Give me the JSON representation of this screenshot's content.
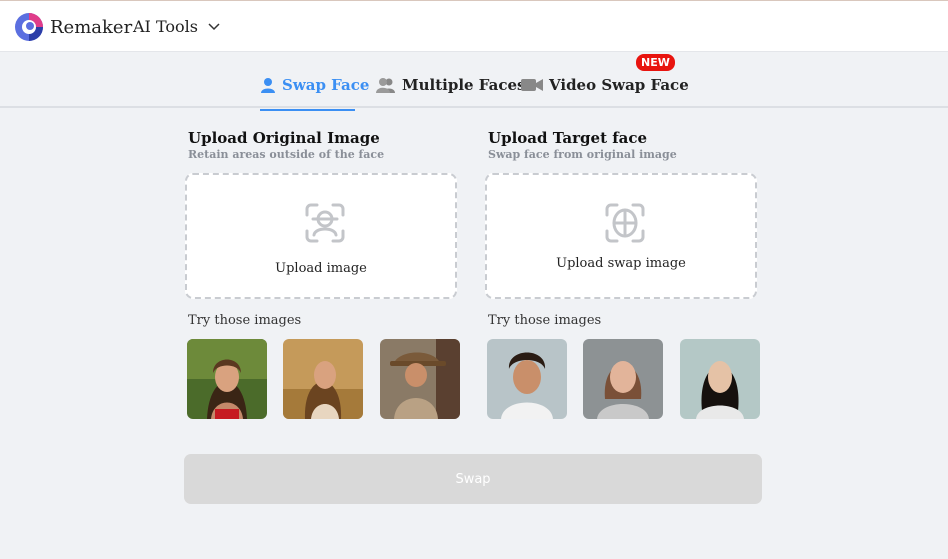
{
  "header": {
    "brand": "Remaker",
    "menu_label": "AI Tools"
  },
  "tabs": [
    {
      "label": "Swap Face",
      "active": true,
      "icon": "person-icon"
    },
    {
      "label": "Multiple Faces",
      "active": false,
      "icon": "people-icon"
    },
    {
      "label": "Video Swap Face",
      "active": false,
      "icon": "video-camera-icon"
    }
  ],
  "new_badge": "NEW",
  "original": {
    "title": "Upload Original Image",
    "subtitle": "Retain areas outside of the face",
    "upload_label": "Upload image",
    "try_label": "Try those images",
    "samples": [
      "woman in red top",
      "woman in golden field",
      "cowboy with hat"
    ]
  },
  "target": {
    "title": "Upload Target face",
    "subtitle": "Swap face from original image",
    "upload_label": "Upload swap image",
    "try_label": "Try those images",
    "samples": [
      "man with curly hair",
      "woman with freckles",
      "asian woman"
    ]
  },
  "swap_button": "Swap",
  "colors": {
    "accent": "#3b8ff3",
    "badge": "#e8140f",
    "disabled_button": "#d9d9d9",
    "background": "#f0f2f5"
  }
}
